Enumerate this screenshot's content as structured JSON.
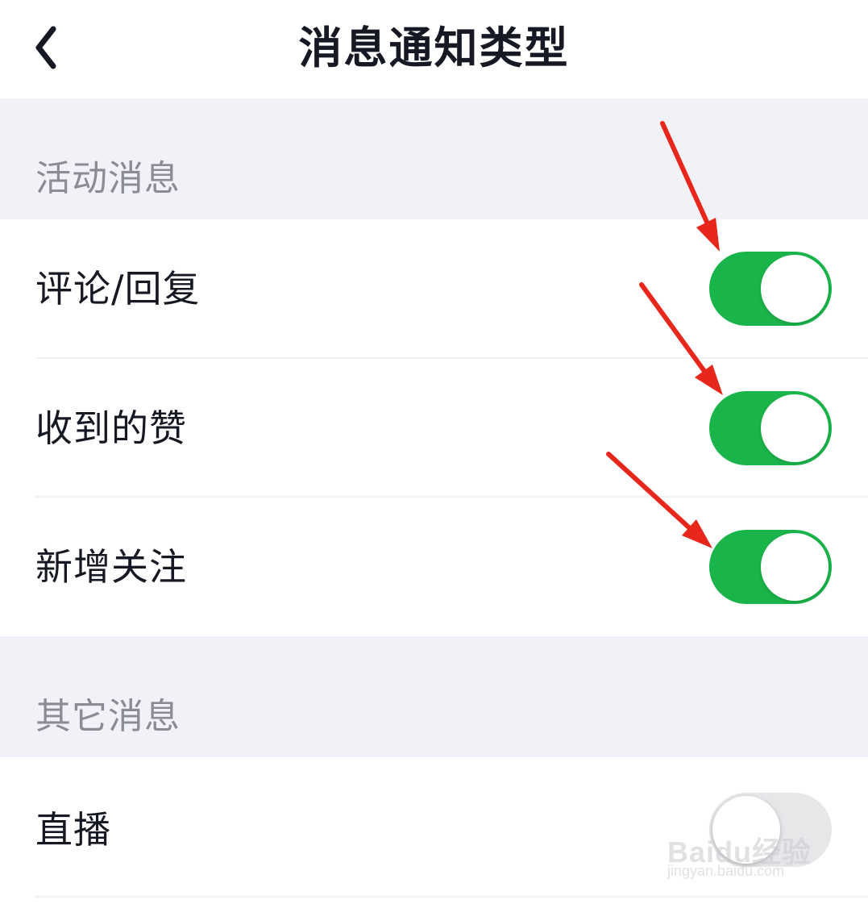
{
  "header": {
    "title": "消息通知类型",
    "back_icon": "chevron-left-icon"
  },
  "sections": [
    {
      "label": "活动消息",
      "items": [
        {
          "label": "评论/回复",
          "enabled": true
        },
        {
          "label": "收到的赞",
          "enabled": true
        },
        {
          "label": "新增关注",
          "enabled": true
        }
      ]
    },
    {
      "label": "其它消息",
      "items": [
        {
          "label": "直播",
          "enabled": false
        }
      ]
    }
  ],
  "colors": {
    "toggle_on": "#1ab54a",
    "toggle_off": "#e7e7ea",
    "section_bg": "#f1f2f8",
    "annotation_arrow": "#e8271c"
  },
  "watermark": {
    "logo": "Baidu经验",
    "url": "jingyan.baidu.com"
  }
}
